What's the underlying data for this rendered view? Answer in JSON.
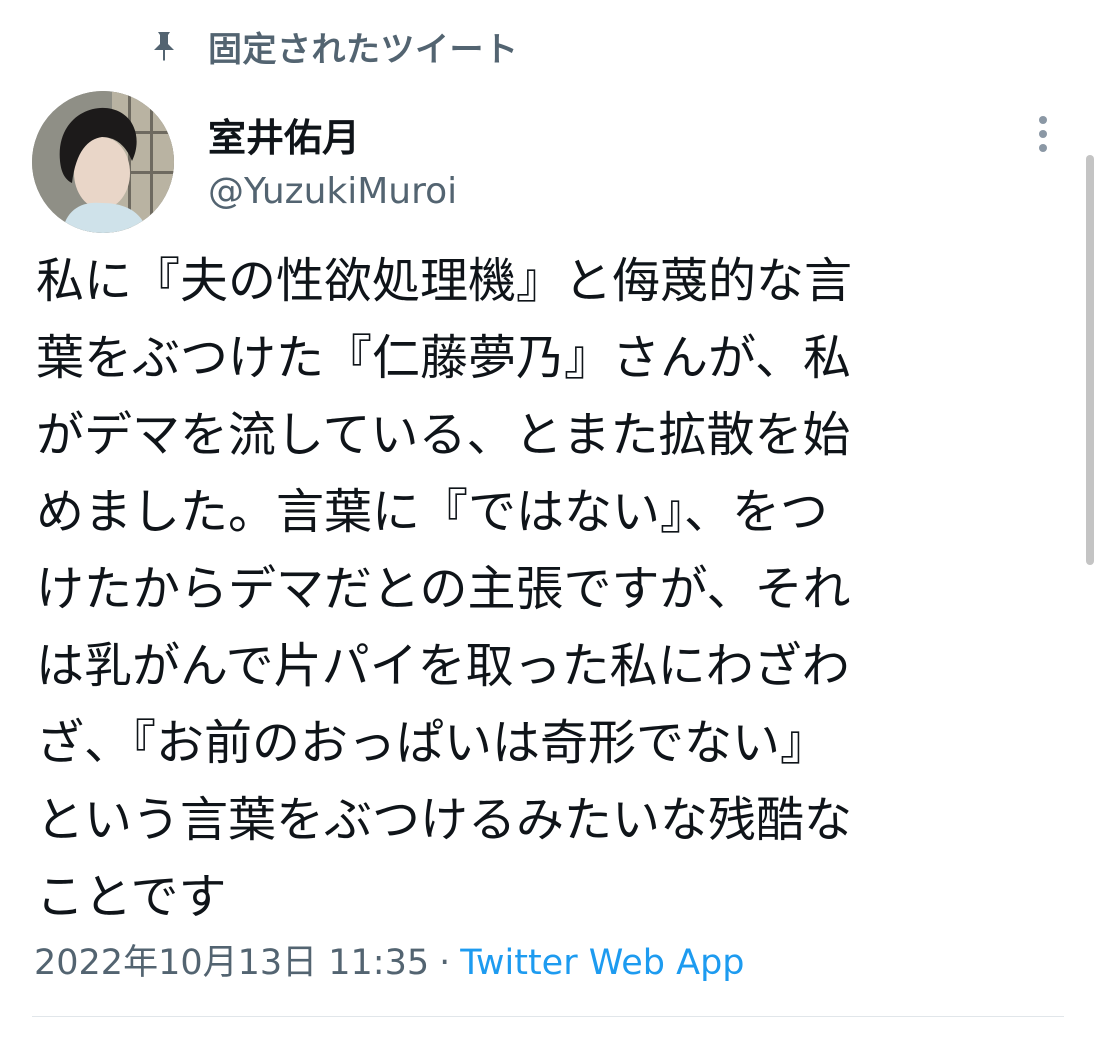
{
  "pinned": {
    "icon": "pin-icon",
    "label": "固定されたツイート"
  },
  "author": {
    "display_name": "室井佑月",
    "handle": "@YuzukiMuroi"
  },
  "tweet": {
    "text": "私に『夫の性欲処理機』と侮蔑的な言\n葉をぶつけた『仁藤夢乃』さんが、私\nがデマを流している、とまた拡散を始\nめました。言葉に『ではない』、をつ\nけたからデマだとの主張ですが、それ\nは乳がんで片パイを取った私にわざわ\nざ、『お前のおっぱいは奇形でない』\nという言葉をぶつけるみたいな残酷な\nことです",
    "timestamp": "2022年10月13日 11:35",
    "separator": "·",
    "source": "Twitter Web App"
  },
  "icons": {
    "more": "more-vertical-icon"
  },
  "colors": {
    "text_primary": "#0f1419",
    "text_secondary": "#536471",
    "link": "#1d9bf0",
    "divider": "#e1e6ea"
  }
}
